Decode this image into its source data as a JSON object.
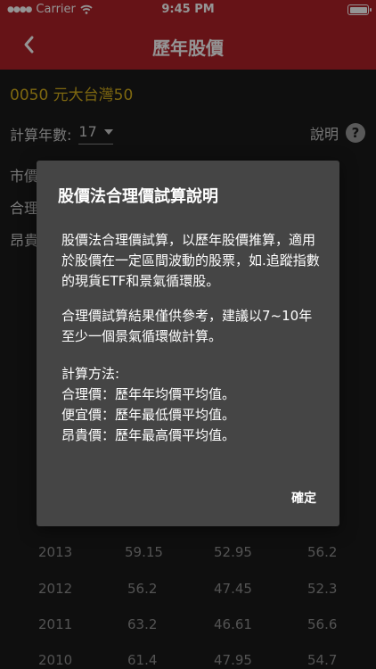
{
  "status_bar": {
    "carrier": "Carrier",
    "time": "9:45 PM"
  },
  "nav": {
    "title": "歷年股價",
    "back_icon": "chevron-left-icon"
  },
  "stock": {
    "title": "0050 元大台灣50"
  },
  "calc": {
    "years_label": "計算年數:",
    "years_value": "17",
    "help_label": "說明",
    "help_icon": "question-circle-icon"
  },
  "metrics": [
    "市價",
    "合理",
    "昂貴"
  ],
  "table": {
    "rows": [
      [
        "2013",
        "59.15",
        "52.95",
        "56.2"
      ],
      [
        "2012",
        "56.2",
        "47.45",
        "52.3"
      ],
      [
        "2011",
        "63.2",
        "46.61",
        "56.6"
      ],
      [
        "2010",
        "61.4",
        "47.95",
        "54.7"
      ]
    ]
  },
  "dialog": {
    "title": "股價法合理價試算說明",
    "para1": "股價法合理價試算，以歷年股價推算，適用於股價在一定區間波動的股票，如.追蹤指數的現貨ETF和景氣循環股。",
    "para2": "合理價試算結果僅供參考，建議以7~10年至少一個景氣循環做計算。",
    "method_title": "計算方法:",
    "method_lines": [
      "合理價：歷年年均價平均值。",
      "便宜價：歷年最低價平均值。",
      "昂貴價：歷年最高價平均值。"
    ],
    "ok_label": "確定"
  },
  "colors": {
    "nav_bg": "#b02228",
    "accent_gold": "#d8b11c",
    "dialog_bg": "#454545"
  }
}
